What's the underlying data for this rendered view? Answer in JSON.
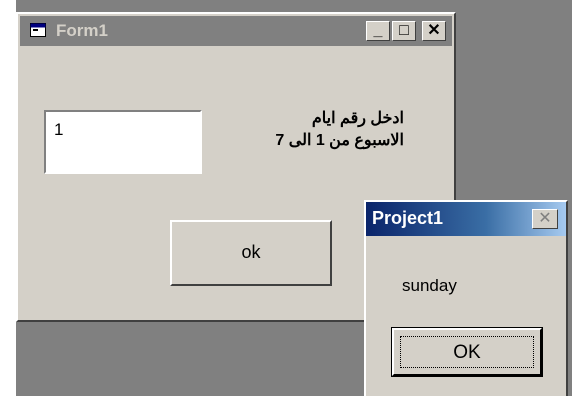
{
  "form1": {
    "title": "Form1",
    "minimize_glyph": "_",
    "maximize_glyph": "□",
    "close_glyph": "✕",
    "textbox_value": "1",
    "prompt_line1": "ادخل رقم ايام",
    "prompt_line2": "الاسبوع من 1 الى 7",
    "ok_label": "ok"
  },
  "msgbox": {
    "title": "Project1",
    "close_glyph": "✕",
    "message": "sunday",
    "ok_label": "OK"
  }
}
